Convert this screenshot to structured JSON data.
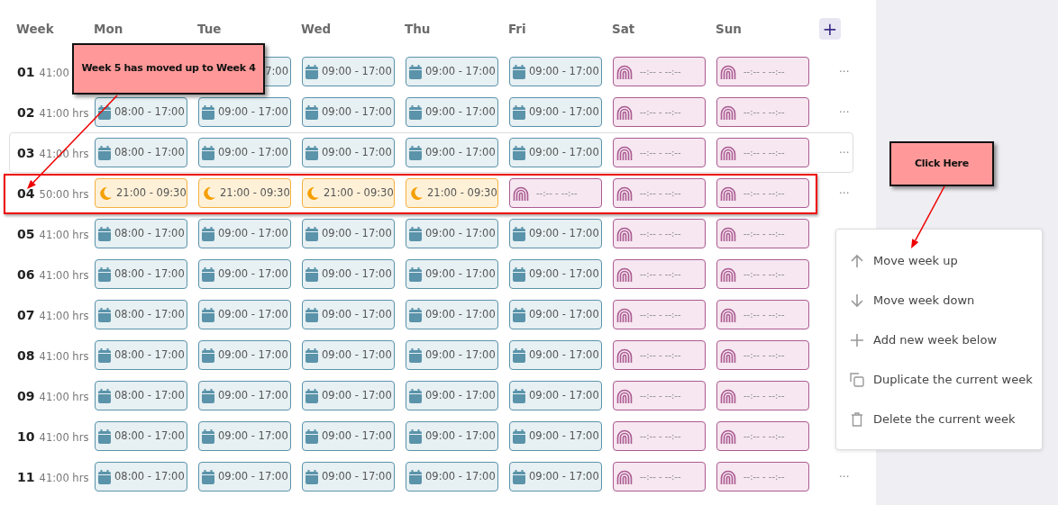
{
  "header": {
    "week_label": "Week",
    "days": [
      "Mon",
      "Tue",
      "Wed",
      "Thu",
      "Fri",
      "Sat",
      "Sun"
    ],
    "add_button": "+"
  },
  "weeks": [
    {
      "number": "01",
      "hours": "41:00",
      "highlighted": false,
      "outlined": false,
      "shifts": [
        {
          "kind": "hidden"
        },
        {
          "kind": "day",
          "time": "7:00",
          "clipped": true
        },
        {
          "kind": "day",
          "time": "09:00 - 17:00"
        },
        {
          "kind": "day",
          "time": "09:00 - 17:00"
        },
        {
          "kind": "day",
          "time": "09:00 - 17:00"
        },
        {
          "kind": "off",
          "time": "--:-- - --:--"
        },
        {
          "kind": "off",
          "time": "--:-- - --:--"
        }
      ],
      "more": "···"
    },
    {
      "number": "02",
      "hours": "41:00 hrs",
      "highlighted": false,
      "outlined": false,
      "shifts": [
        {
          "kind": "day",
          "time": "08:00 - 17:00"
        },
        {
          "kind": "day",
          "time": "09:00 - 17:00"
        },
        {
          "kind": "day",
          "time": "09:00 - 17:00"
        },
        {
          "kind": "day",
          "time": "09:00 - 17:00"
        },
        {
          "kind": "day",
          "time": "09:00 - 17:00"
        },
        {
          "kind": "off",
          "time": "--:-- - --:--"
        },
        {
          "kind": "off",
          "time": "--:-- - --:--"
        }
      ],
      "more": "···"
    },
    {
      "number": "03",
      "hours": "41:00 hrs",
      "highlighted": true,
      "outlined": false,
      "shifts": [
        {
          "kind": "day",
          "time": "08:00 - 17:00"
        },
        {
          "kind": "day",
          "time": "09:00 - 17:00"
        },
        {
          "kind": "day",
          "time": "09:00 - 17:00"
        },
        {
          "kind": "day",
          "time": "09:00 - 17:00"
        },
        {
          "kind": "day",
          "time": "09:00 - 17:00"
        },
        {
          "kind": "off",
          "time": "--:-- - --:--"
        },
        {
          "kind": "off",
          "time": "--:-- - --:--"
        }
      ],
      "more": "···"
    },
    {
      "number": "04",
      "hours": "50:00 hrs",
      "highlighted": false,
      "outlined": true,
      "shifts": [
        {
          "kind": "night",
          "time": "21:00 - 09:30"
        },
        {
          "kind": "night",
          "time": "21:00 - 09:30"
        },
        {
          "kind": "night",
          "time": "21:00 - 09:30"
        },
        {
          "kind": "night",
          "time": "21:00 - 09:30"
        },
        {
          "kind": "off",
          "time": "--:-- - --:--"
        },
        {
          "kind": "off",
          "time": "--:-- - --:--"
        },
        {
          "kind": "off",
          "time": "--:-- - --:--"
        }
      ],
      "more": "···"
    },
    {
      "number": "05",
      "hours": "41:00 hrs",
      "highlighted": false,
      "outlined": false,
      "shifts": [
        {
          "kind": "day",
          "time": "08:00 - 17:00"
        },
        {
          "kind": "day",
          "time": "09:00 - 17:00"
        },
        {
          "kind": "day",
          "time": "09:00 - 17:00"
        },
        {
          "kind": "day",
          "time": "09:00 - 17:00"
        },
        {
          "kind": "day",
          "time": "09:00 - 17:00"
        },
        {
          "kind": "off",
          "time": "--:-- - --:--"
        },
        {
          "kind": "off",
          "time": "--:-- - --:--"
        }
      ]
    },
    {
      "number": "06",
      "hours": "41:00 hrs",
      "highlighted": false,
      "outlined": false,
      "shifts": [
        {
          "kind": "day",
          "time": "08:00 - 17:00"
        },
        {
          "kind": "day",
          "time": "09:00 - 17:00"
        },
        {
          "kind": "day",
          "time": "09:00 - 17:00"
        },
        {
          "kind": "day",
          "time": "09:00 - 17:00"
        },
        {
          "kind": "day",
          "time": "09:00 - 17:00"
        },
        {
          "kind": "off",
          "time": "--:-- - --:--"
        },
        {
          "kind": "off",
          "time": "--:-- - --:--"
        }
      ]
    },
    {
      "number": "07",
      "hours": "41:00 hrs",
      "highlighted": false,
      "outlined": false,
      "shifts": [
        {
          "kind": "day",
          "time": "08:00 - 17:00"
        },
        {
          "kind": "day",
          "time": "09:00 - 17:00"
        },
        {
          "kind": "day",
          "time": "09:00 - 17:00"
        },
        {
          "kind": "day",
          "time": "09:00 - 17:00"
        },
        {
          "kind": "day",
          "time": "09:00 - 17:00"
        },
        {
          "kind": "off",
          "time": "--:-- - --:--"
        },
        {
          "kind": "off",
          "time": "--:-- - --:--"
        }
      ]
    },
    {
      "number": "08",
      "hours": "41:00 hrs",
      "highlighted": false,
      "outlined": false,
      "shifts": [
        {
          "kind": "day",
          "time": "08:00 - 17:00"
        },
        {
          "kind": "day",
          "time": "09:00 - 17:00"
        },
        {
          "kind": "day",
          "time": "09:00 - 17:00"
        },
        {
          "kind": "day",
          "time": "09:00 - 17:00"
        },
        {
          "kind": "day",
          "time": "09:00 - 17:00"
        },
        {
          "kind": "off",
          "time": "--:-- - --:--"
        },
        {
          "kind": "off",
          "time": "--:-- - --:--"
        }
      ]
    },
    {
      "number": "09",
      "hours": "41:00 hrs",
      "highlighted": false,
      "outlined": false,
      "shifts": [
        {
          "kind": "day",
          "time": "08:00 - 17:00"
        },
        {
          "kind": "day",
          "time": "09:00 - 17:00"
        },
        {
          "kind": "day",
          "time": "09:00 - 17:00"
        },
        {
          "kind": "day",
          "time": "09:00 - 17:00"
        },
        {
          "kind": "day",
          "time": "09:00 - 17:00"
        },
        {
          "kind": "off",
          "time": "--:-- - --:--"
        },
        {
          "kind": "off",
          "time": "--:-- - --:--"
        }
      ]
    },
    {
      "number": "10",
      "hours": "41:00 hrs",
      "highlighted": false,
      "outlined": false,
      "shifts": [
        {
          "kind": "day",
          "time": "08:00 - 17:00"
        },
        {
          "kind": "day",
          "time": "09:00 - 17:00"
        },
        {
          "kind": "day",
          "time": "09:00 - 17:00"
        },
        {
          "kind": "day",
          "time": "09:00 - 17:00"
        },
        {
          "kind": "day",
          "time": "09:00 - 17:00"
        },
        {
          "kind": "off",
          "time": "--:-- - --:--"
        },
        {
          "kind": "off",
          "time": "--:-- - --:--"
        }
      ]
    },
    {
      "number": "11",
      "hours": "41:00 hrs",
      "highlighted": false,
      "outlined": false,
      "shifts": [
        {
          "kind": "day",
          "time": "08:00 - 17:00"
        },
        {
          "kind": "day",
          "time": "09:00 - 17:00"
        },
        {
          "kind": "day",
          "time": "09:00 - 17:00"
        },
        {
          "kind": "day",
          "time": "09:00 - 17:00"
        },
        {
          "kind": "day",
          "time": "09:00 - 17:00"
        },
        {
          "kind": "off",
          "time": "--:-- - --:--"
        },
        {
          "kind": "off",
          "time": "--:-- - --:--"
        }
      ],
      "more": "···"
    }
  ],
  "context_menu": {
    "items": [
      {
        "kind": "up",
        "label": "Move week up"
      },
      {
        "kind": "down",
        "label": "Move week down"
      },
      {
        "kind": "add",
        "label": "Add new week below"
      },
      {
        "kind": "duplicate",
        "label": "Duplicate the current week"
      },
      {
        "kind": "delete",
        "label": "Delete the current week"
      }
    ]
  },
  "callouts": [
    {
      "text": "Week 5 has moved up to Week 4"
    },
    {
      "text": "Click Here"
    }
  ]
}
